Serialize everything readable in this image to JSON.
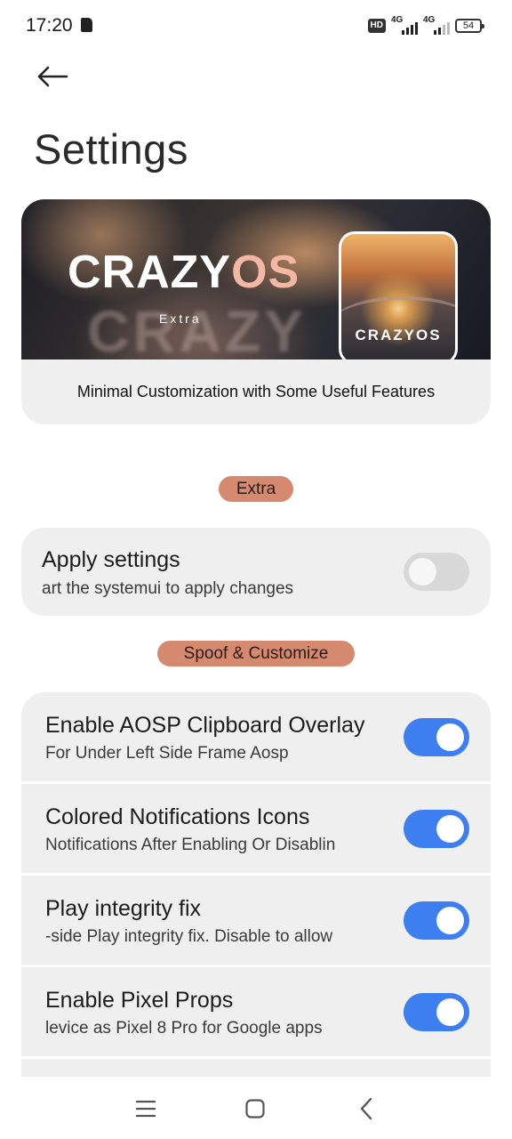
{
  "status_bar": {
    "time": "17:20",
    "hd_badge": "HD",
    "network_1": "4G",
    "network_2": "4G",
    "battery": "54"
  },
  "header": {
    "title": "Settings"
  },
  "banner": {
    "logo_part_1": "CRAZY",
    "logo_part_2": "OS",
    "ghost_text": "CRAZY",
    "subtitle": "Extra",
    "thumb_logo": "CRAZYOS",
    "description": "Minimal Customization with Some Useful Features"
  },
  "sections": {
    "extra": "Extra",
    "spoof": "Spoof & Customize"
  },
  "settings": [
    {
      "title": "Apply settings",
      "summary": "art the systemui to apply changes",
      "enabled": false
    },
    {
      "title": "Enable AOSP Clipboard Overlay",
      "summary": "For Under Left Side Frame Aosp",
      "enabled": true
    },
    {
      "title": "Colored Notifications Icons",
      "summary": "Notifications After Enabling Or Disablin",
      "enabled": true
    },
    {
      "title": "Play integrity fix",
      "summary": "-side Play integrity fix. Disable to allow",
      "enabled": true
    },
    {
      "title": "Enable Pixel Props",
      "summary": "levice as Pixel 8 Pro for Google apps",
      "enabled": true
    }
  ],
  "colors": {
    "accent_toggle": "#3d7ef0",
    "section_pill": "#d58a6f",
    "card_bg": "#efefef"
  }
}
